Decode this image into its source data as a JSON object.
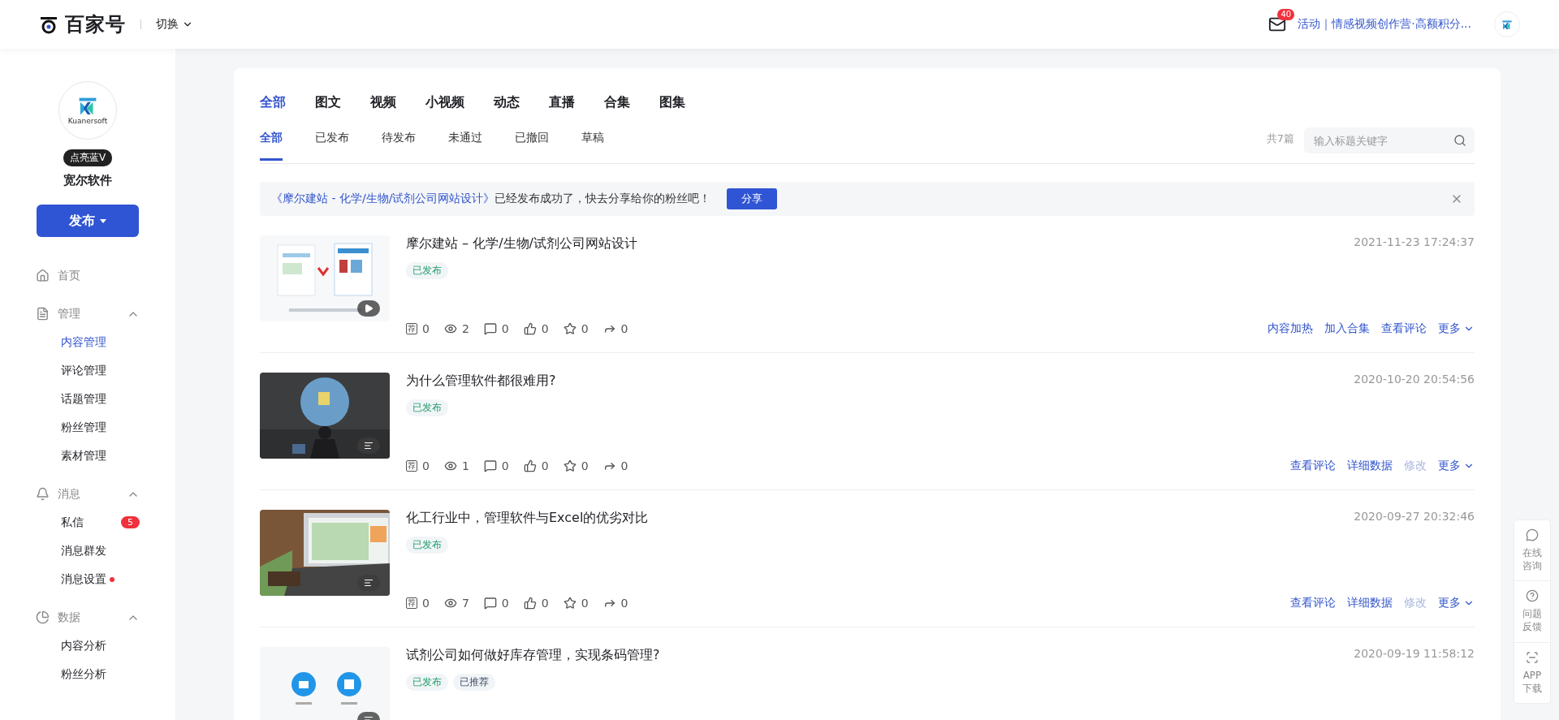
{
  "header": {
    "brand": "百家号",
    "switch_label": "切换",
    "mail_count": "40",
    "promo": "活动｜情感视频创作营·高额积分..."
  },
  "sidebar": {
    "avatar_text": "Kuanersoft",
    "badge": "点亮蓝V",
    "account_name": "宽尔软件",
    "publish_label": "发布",
    "nav": [
      {
        "kind": "home",
        "label": "首页"
      },
      {
        "kind": "manage",
        "label": "管理",
        "expanded": true,
        "children": [
          {
            "label": "内容管理",
            "selected": true
          },
          {
            "label": "评论管理",
            "selected": false
          },
          {
            "label": "话题管理",
            "selected": false
          },
          {
            "label": "粉丝管理",
            "selected": false
          },
          {
            "label": "素材管理",
            "selected": false
          }
        ]
      },
      {
        "kind": "message",
        "label": "消息",
        "expanded": true,
        "children": [
          {
            "label": "私信",
            "selected": false,
            "count": "5"
          },
          {
            "label": "消息群发",
            "selected": false
          },
          {
            "label": "消息设置",
            "selected": false,
            "dot": true
          }
        ]
      },
      {
        "kind": "data",
        "label": "数据",
        "expanded": true,
        "children": [
          {
            "label": "内容分析",
            "selected": false
          },
          {
            "label": "粉丝分析",
            "selected": false
          }
        ]
      }
    ]
  },
  "type_tabs": [
    {
      "label": "全部",
      "selected": true
    },
    {
      "label": "图文",
      "selected": false
    },
    {
      "label": "视频",
      "selected": false
    },
    {
      "label": "小视频",
      "selected": false
    },
    {
      "label": "动态",
      "selected": false
    },
    {
      "label": "直播",
      "selected": false
    },
    {
      "label": "合集",
      "selected": false
    },
    {
      "label": "图集",
      "selected": false
    }
  ],
  "status_tabs": [
    {
      "label": "全部",
      "selected": true
    },
    {
      "label": "已发布",
      "selected": false
    },
    {
      "label": "待发布",
      "selected": false
    },
    {
      "label": "未通过",
      "selected": false
    },
    {
      "label": "已撤回",
      "selected": false
    },
    {
      "label": "草稿",
      "selected": false
    }
  ],
  "total": "共7篇",
  "search": {
    "placeholder": "输入标题关键字"
  },
  "notice": {
    "link": "《摩尔建站 - 化学/生物/试剂公司网站设计》",
    "text": "已经发布成功了，快去分享给你的粉丝吧！",
    "button": "分享"
  },
  "articles": [
    {
      "title": "摩尔建站 – 化学/生物/试剂公司网站设计",
      "time": "2021-11-23 17:24:37",
      "kind": "video",
      "tags": [
        {
          "label": "已发布",
          "kind": "published"
        }
      ],
      "stats": [
        {
          "kind": "recommend",
          "icon_text": "荐",
          "value": "0"
        },
        {
          "kind": "views",
          "value": "2"
        },
        {
          "kind": "comments",
          "value": "0"
        },
        {
          "kind": "likes",
          "value": "0"
        },
        {
          "kind": "favorites",
          "value": "0"
        },
        {
          "kind": "shares",
          "value": "0"
        }
      ],
      "actions": [
        {
          "label": "内容加热",
          "disabled": false,
          "kind": "link"
        },
        {
          "label": "加入合集",
          "disabled": false,
          "kind": "link"
        },
        {
          "label": "查看评论",
          "disabled": false,
          "kind": "link"
        },
        {
          "label": "更多",
          "disabled": false,
          "kind": "menu"
        }
      ]
    },
    {
      "title": "为什么管理软件都很难用?",
      "time": "2020-10-20 20:54:56",
      "kind": "article",
      "tags": [
        {
          "label": "已发布",
          "kind": "published"
        }
      ],
      "stats": [
        {
          "kind": "recommend",
          "icon_text": "荐",
          "value": "0"
        },
        {
          "kind": "views",
          "value": "1"
        },
        {
          "kind": "comments",
          "value": "0"
        },
        {
          "kind": "likes",
          "value": "0"
        },
        {
          "kind": "favorites",
          "value": "0"
        },
        {
          "kind": "shares",
          "value": "0"
        }
      ],
      "actions": [
        {
          "label": "查看评论",
          "disabled": false,
          "kind": "link"
        },
        {
          "label": "详细数据",
          "disabled": false,
          "kind": "link"
        },
        {
          "label": "修改",
          "disabled": true,
          "kind": "link"
        },
        {
          "label": "更多",
          "disabled": false,
          "kind": "menu"
        }
      ]
    },
    {
      "title": "化工行业中，管理软件与Excel的优劣对比",
      "time": "2020-09-27 20:32:46",
      "kind": "article",
      "tags": [
        {
          "label": "已发布",
          "kind": "published"
        }
      ],
      "stats": [
        {
          "kind": "recommend",
          "icon_text": "荐",
          "value": "0"
        },
        {
          "kind": "views",
          "value": "7"
        },
        {
          "kind": "comments",
          "value": "0"
        },
        {
          "kind": "likes",
          "value": "0"
        },
        {
          "kind": "favorites",
          "value": "0"
        },
        {
          "kind": "shares",
          "value": "0"
        }
      ],
      "actions": [
        {
          "label": "查看评论",
          "disabled": false,
          "kind": "link"
        },
        {
          "label": "详细数据",
          "disabled": false,
          "kind": "link"
        },
        {
          "label": "修改",
          "disabled": true,
          "kind": "link"
        },
        {
          "label": "更多",
          "disabled": false,
          "kind": "menu"
        }
      ]
    },
    {
      "title": "试剂公司如何做好库存管理，实现条码管理?",
      "time": "2020-09-19 11:58:12",
      "kind": "article",
      "tags": [
        {
          "label": "已发布",
          "kind": "published"
        },
        {
          "label": "已推荐",
          "kind": "recommended"
        }
      ]
    }
  ],
  "float_panel": [
    {
      "kind": "chat",
      "label": "在线咨询"
    },
    {
      "kind": "help",
      "label": "问题反馈"
    },
    {
      "kind": "app",
      "label": "APP下载"
    }
  ]
}
